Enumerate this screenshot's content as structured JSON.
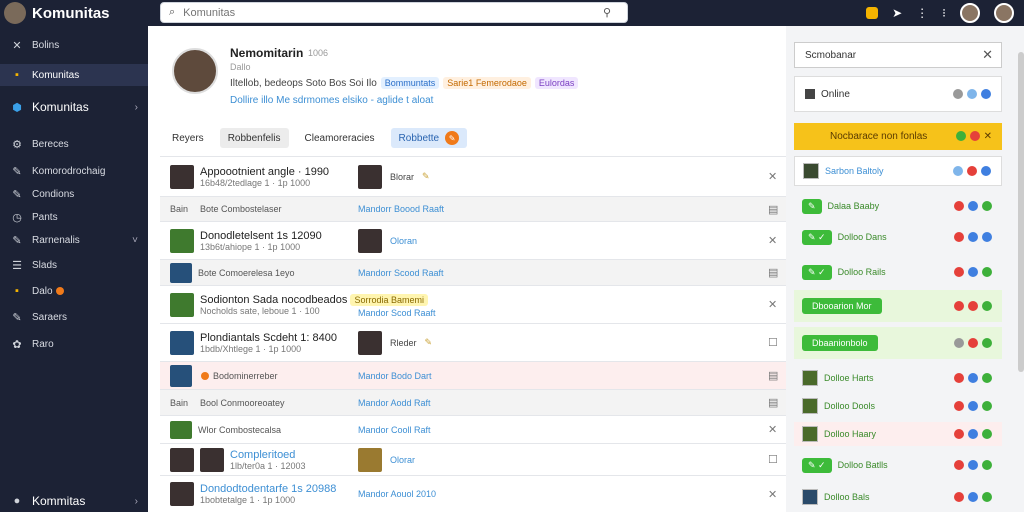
{
  "app": {
    "title": "Komunitas"
  },
  "search": {
    "placeholder": "Komunitas"
  },
  "sidebar": {
    "items": [
      {
        "label": "Bolins",
        "icon": "grid-icon"
      },
      {
        "label": "Komunitas",
        "icon": "folder-icon"
      },
      {
        "label": "Komunitas",
        "icon": "cube-icon"
      },
      {
        "label": "Bereces",
        "icon": "gear-icon"
      },
      {
        "label": "Komorodrochaig",
        "icon": "pencil-icon"
      },
      {
        "label": "Condions",
        "icon": "pencil-icon"
      },
      {
        "label": "Pants",
        "icon": "clock-icon"
      },
      {
        "label": "Rarnenalis",
        "icon": "pencil-icon"
      },
      {
        "label": "Slads",
        "icon": "list-icon"
      },
      {
        "label": "Dalo",
        "icon": "bookmark-icon"
      },
      {
        "label": "Saraers",
        "icon": "pencil-icon"
      },
      {
        "label": "Raro",
        "icon": "flower-icon"
      }
    ],
    "footer_label": "Kommitas"
  },
  "profile": {
    "name": "Nemomitarin",
    "name_suffix": "1006",
    "subtitle": "Dallo",
    "line": "Iltellob, bedeops Soto Bos Soi Ilo",
    "tags": [
      "Bommuntats",
      "Sarie1 Femerodaoe",
      "Eulordas"
    ],
    "link": "Dollire illo Me sdrmomes elsiko - aglide t aloat"
  },
  "tabs": [
    {
      "label": "Reyers"
    },
    {
      "label": "Robbenfelis"
    },
    {
      "label": "Cleamoreracies"
    },
    {
      "label": "Robbette"
    }
  ],
  "rows": [
    {
      "title": "Appoootnient angle · 1990",
      "sub": "16b48/2tedlage 1 · 1p 1000",
      "media_label": "Blorar"
    },
    {
      "col1": "Bain",
      "small": "Bote Combostelaser",
      "link": "Mandorr Boood Raaft"
    },
    {
      "title": "Donodletelsent 1s 12090",
      "sub": "13b6t/ahiope 1 · 1p 1000",
      "media_label": "Oloran"
    },
    {
      "small": "Bote Comoerelesa 1eyo",
      "link": "Mandorr Scood Raaft"
    },
    {
      "title": "Sodionton Sada  nocodbeados",
      "tag": "Sorrodia Bamemi",
      "sub": "Nocholds sate, leboue 1 · 100",
      "link": "Mandor Scod Raaft"
    },
    {
      "title": "Plondiantals Scdeht 1: 8400",
      "sub": "1bdb/Xhtlege 1 · 1p 1000",
      "media_label": "Rleder"
    },
    {
      "small": "Bodominerreber",
      "link": "Mandor Bodo Dart"
    },
    {
      "col1": "Bain",
      "small": "Bool Conmooreoatey",
      "link": "Mandor Aodd Raft"
    },
    {
      "small": "Wlor Combostecalsa",
      "link": "Mandor Cooll Raft"
    },
    {
      "title": "Compleritoed",
      "sub": "1lb/ter0a 1 · 12003",
      "media_label": "Olorar"
    },
    {
      "title": "Dondodtodentarfe 1s 20988",
      "sub": "1bobtetalge 1 · 1p 1000",
      "link": "Mandor Aouol 2010"
    }
  ],
  "right": {
    "search_label": "Scmobanar",
    "online_label": "Online",
    "bar_label": "Nocbarace non fonlas",
    "cards": [
      {
        "label": "Sarbon Baltoly"
      },
      {
        "label": "Dalaa Baaby"
      },
      {
        "label": "Dolloo Dans"
      },
      {
        "label": "Dolloo Rails"
      },
      {
        "label": "Dbooarion Mor"
      },
      {
        "label": "Dbaanionbolo"
      },
      {
        "label": "Dolloe Harts"
      },
      {
        "label": "Dolloo Dools"
      },
      {
        "label": "Dolloo Haary"
      },
      {
        "label": "Dolloo Batlls"
      },
      {
        "label": "Dolloo Bals"
      }
    ]
  },
  "colors": {
    "sidebar": "#1c2235",
    "accent": "#f6c21a",
    "green": "#3dbb3a",
    "link": "#3d8fd4"
  }
}
